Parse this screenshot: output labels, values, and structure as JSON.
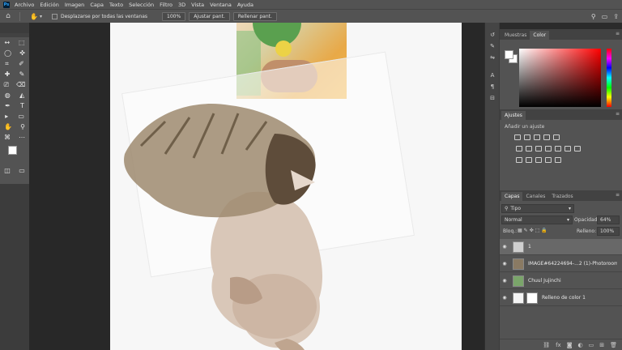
{
  "app": {
    "logo": "Ps"
  },
  "menu": [
    "Archivo",
    "Edición",
    "Imagen",
    "Capa",
    "Texto",
    "Selección",
    "Filtro",
    "3D",
    "Vista",
    "Ventana",
    "Ayuda"
  ],
  "options": {
    "scroll_all_label": "Desplazarse por todas las ventanas",
    "zoom_value": "100%",
    "fit_screen_label": "Ajustar pant.",
    "fill_screen_label": "Rellenar pant."
  },
  "tools": [
    [
      "↔",
      "⬚"
    ],
    [
      "◯",
      "✜"
    ],
    [
      "⌗",
      "✐"
    ],
    [
      "✚",
      "✎"
    ],
    [
      "⎚",
      "⌫"
    ],
    [
      "◍",
      "◭"
    ],
    [
      "✒",
      "T"
    ],
    [
      "▸",
      "▭"
    ],
    [
      "✋",
      "⚲"
    ],
    [
      "⌘",
      "⋯"
    ]
  ],
  "panels": {
    "color_tabs": [
      "Muestras",
      "Color"
    ],
    "adjust_tab": "Ajustes",
    "adjust_label": "Añadir un ajuste",
    "layer_tabs": [
      "Capas",
      "Canales",
      "Trazados"
    ],
    "kind_label": "Tipo",
    "blend_mode": "Normal",
    "opacity_label": "Opacidad:",
    "opacity_value": "64%",
    "lock_label": "Bloq.:",
    "fill_label": "Relleno:",
    "fill_value": "100%",
    "panel_menu_glyph": "≡"
  },
  "layers": [
    {
      "name": "1",
      "selected": true
    },
    {
      "name": "IMAGE#64224694-...2 (1)-Photoroom",
      "selected": false
    },
    {
      "name": "Chuul Jujinchi",
      "selected": false
    },
    {
      "name": "Relleno de color 1",
      "selected": false
    }
  ],
  "icons": {
    "home": "⌂",
    "hand": "✋",
    "search": "⚲",
    "window": "▭",
    "share": "⇪",
    "eye": "◉",
    "fx": "fx"
  },
  "colors": {
    "accent": "#31a8ff",
    "panel": "#535353",
    "canvas": "#f7f7f7"
  }
}
